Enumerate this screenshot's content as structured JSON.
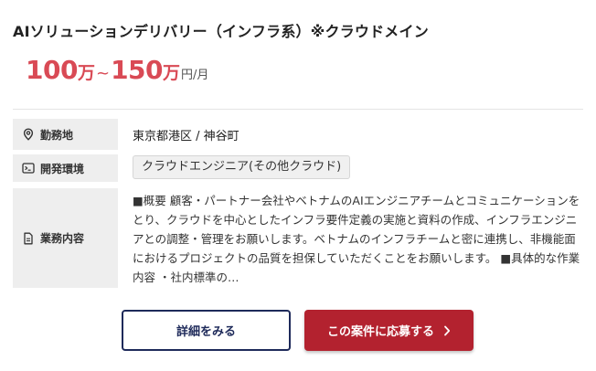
{
  "job": {
    "title": "AIソリューションデリバリー（インフラ系）※クラウドメイン",
    "salary": {
      "min": "100",
      "min_unit": "万",
      "separator": "~",
      "max": "150",
      "max_unit": "万",
      "period": "円/月"
    }
  },
  "details": {
    "location": {
      "label": "勤務地",
      "icon": "map-pin-icon",
      "value": "東京都港区 / 神谷町"
    },
    "environment": {
      "label": "開発環境",
      "icon": "terminal-icon",
      "tag": "クラウドエンジニア(その他クラウド)"
    },
    "description": {
      "label": "業務内容",
      "icon": "document-icon",
      "text": "■概要 顧客・パートナー会社やベトナムのAIエンジニアチームとコミュニケーションをとり、クラウドを中心としたインフラ要件定義の実施と資料の作成、インフラエンジニアとの調整・管理をお願いします。ベトナムのインフラチームと密に連携し、非機能面におけるプロジェクトの品質を担保していただくことをお願いします。 ■具体的な作業内容 ・社内標準の…"
    }
  },
  "actions": {
    "detail_label": "詳細をみる",
    "apply_label": "この案件に応募する",
    "apply_icon": "chevron-right-icon"
  },
  "colors": {
    "salary": "#d94a55",
    "apply_button": "#b3222f",
    "detail_border": "#1e2a5a",
    "label_bg": "#eeeeee"
  }
}
